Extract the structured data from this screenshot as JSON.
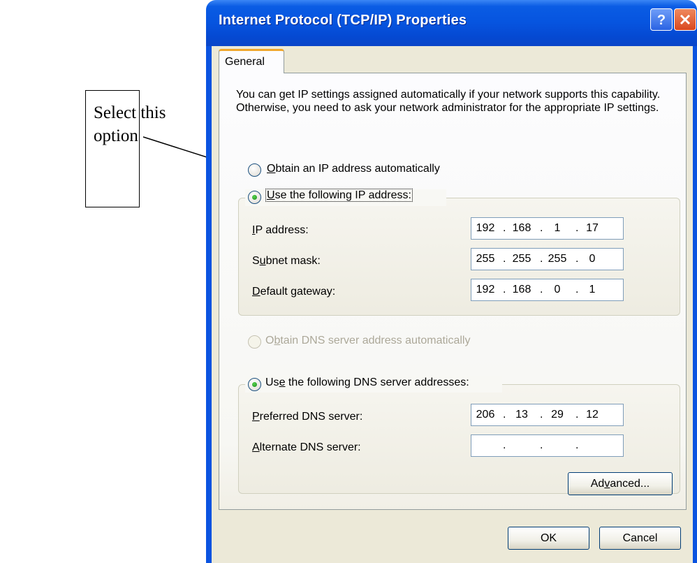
{
  "window": {
    "title": "Internet Protocol (TCP/IP) Properties",
    "titlebar_buttons": {
      "help_icon": "question-mark-icon",
      "close_icon": "x-close-icon"
    }
  },
  "tabs": [
    {
      "label": "General",
      "selected": true
    }
  ],
  "general": {
    "intro": "You can get IP settings assigned automatically if your network supports this capability. Otherwise, you need to ask your network administrator for the appropriate IP settings.",
    "ip_mode": {
      "auto_label_key": "O",
      "auto_label_rest": "btain an IP address automatically",
      "auto_selected": false,
      "manual_label_key": "U",
      "manual_label_rest": "se the following IP address:",
      "manual_selected": true
    },
    "ip_fields": [
      {
        "label_key": "I",
        "label_rest": "P address:",
        "octets": [
          "192",
          "168",
          "1",
          "17"
        ]
      },
      {
        "label_pre": "S",
        "label_key": "u",
        "label_rest": "bnet mask:",
        "octets": [
          "255",
          "255",
          "255",
          "0"
        ]
      },
      {
        "label_key": "D",
        "label_rest": "efault gateway:",
        "octets": [
          "192",
          "168",
          "0",
          "1"
        ]
      }
    ],
    "dns_mode": {
      "auto_label_pre": "O",
      "auto_label_key": "b",
      "auto_label_rest": "tain DNS server address automatically",
      "auto_selected": false,
      "auto_disabled": true,
      "manual_label_pre": "Us",
      "manual_label_key": "e",
      "manual_label_rest": " the following DNS server addresses:",
      "manual_selected": true
    },
    "dns_fields": [
      {
        "label_key": "P",
        "label_rest": "referred DNS server:",
        "octets": [
          "206",
          "13",
          "29",
          "12"
        ]
      },
      {
        "label_key": "A",
        "label_rest": "lternate DNS server:",
        "octets": [
          "",
          "",
          "",
          ""
        ]
      }
    ],
    "advanced_button": {
      "pre": "Ad",
      "key": "v",
      "rest": "anced..."
    }
  },
  "footer": {
    "ok_label": "OK",
    "cancel_label": "Cancel"
  },
  "annotation": {
    "text": "Select this\noption"
  },
  "colors": {
    "titlebar": "#0654df",
    "dialog_bg": "#ece9d8",
    "tab_highlight": "#f0a72b",
    "disabled_text": "#aca899"
  }
}
